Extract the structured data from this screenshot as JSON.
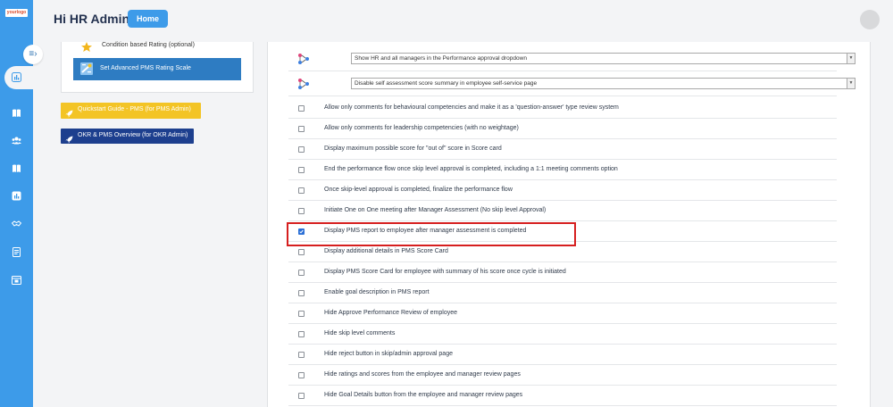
{
  "header": {
    "greeting": "Hi HR Admin",
    "home_label": "Home",
    "logo_text": "yourlogo"
  },
  "sidebar": {
    "icons": [
      "bar-chart-icon",
      "book-icon",
      "users-icon",
      "book-icon",
      "report-icon",
      "handshake-icon",
      "checklist-icon",
      "calendar-icon"
    ],
    "toggle_icon": "collapse-menu-icon"
  },
  "left_panel": {
    "condition_label": "Condition based Rating (optional)",
    "advanced_label": "Set Advanced PMS Rating Scale",
    "quickstart_label": "Quickstart Guide - PMS (for PMS Admin)",
    "okr_label": "OKR & PMS Overview (for OKR Admin)"
  },
  "settings": {
    "dropdowns": [
      {
        "value": "Show HR and all managers in the Performance approval dropdown"
      },
      {
        "value": "Disable self assessment score summary in employee self-service page"
      }
    ],
    "rows": [
      {
        "label": "Allow only comments for behavioural competencies and make it as a 'question-answer' type review system",
        "checked": false
      },
      {
        "label": "Allow only comments for leadership competencies (with no weightage)",
        "checked": false
      },
      {
        "label": "Display maximum possible score for \"out of\" score in Score card",
        "checked": false
      },
      {
        "label": "End the performance flow once skip level approval is completed, including a 1:1 meeting comments option",
        "checked": false
      },
      {
        "label": "Once skip-level approval is completed, finalize the performance flow",
        "checked": false
      },
      {
        "label": "Initiate One on One meeting after Manager Assessment (No skip level Approval)",
        "checked": false
      },
      {
        "label": "Display PMS report to employee after manager assessment is completed",
        "checked": true
      },
      {
        "label": "Display additional details in PMS Score Card",
        "checked": false
      },
      {
        "label": "Display PMS Score Card for employee with summary of his score once cycle is initiated",
        "checked": false
      },
      {
        "label": "Enable goal description in PMS report",
        "checked": false
      },
      {
        "label": "Hide Approve Performance Review of employee",
        "checked": false
      },
      {
        "label": "Hide skip level comments",
        "checked": false
      },
      {
        "label": "Hide reject button in skip/admin approval page",
        "checked": false
      },
      {
        "label": "Hide ratings and scores from the employee and manager review pages",
        "checked": false
      },
      {
        "label": "Hide Goal Details button from the employee and manager review pages",
        "checked": false
      }
    ]
  },
  "colors": {
    "sidebar": "#3d9be9",
    "primary_button": "#2e7cc2",
    "quickstart": "#f3c425",
    "okr": "#1d3f8e",
    "highlight": "#d61f1f"
  }
}
